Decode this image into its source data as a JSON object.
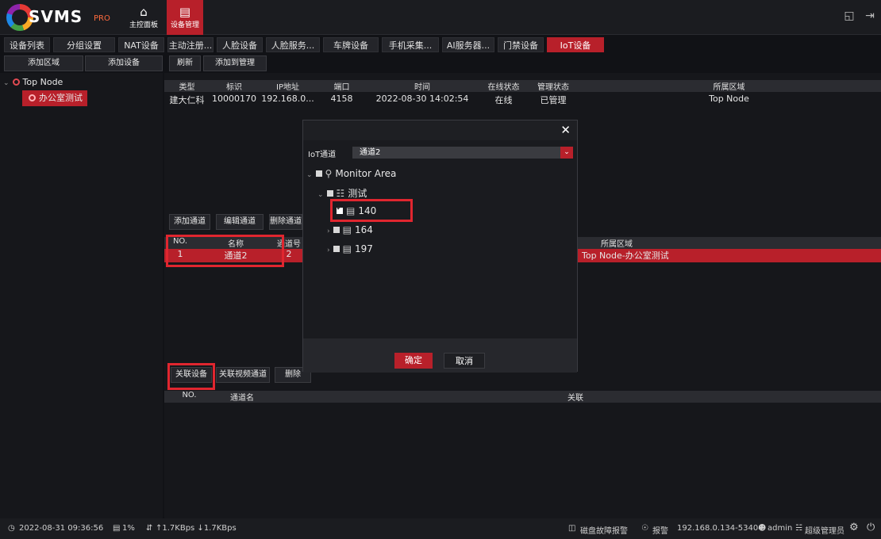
{
  "app": {
    "logo_text": "SVMS",
    "logo_sub": "PRO"
  },
  "topnav": {
    "home_label": "主控面板",
    "device_label": "设备管理"
  },
  "tabs": [
    "设备列表",
    "分组设置",
    "NAT设备",
    "主动注册...",
    "人脸设备",
    "人脸服务...",
    "车牌设备",
    "手机采集...",
    "AI服务器...",
    "门禁设备",
    "IoT设备"
  ],
  "left_toolbar": {
    "add_area": "添加区域",
    "add_device": "添加设备"
  },
  "right_toolbar": {
    "refresh": "刷新",
    "add_to_manage": "添加到管理"
  },
  "tree": {
    "root": "Top Node",
    "child": "办公室测试"
  },
  "device_table": {
    "headers": [
      "类型",
      "标识",
      "IP地址",
      "端口",
      "时间",
      "在线状态",
      "管理状态",
      "所属区域"
    ],
    "rows": [
      [
        "建大仁科",
        "10000170",
        "192.168.0...",
        "4158",
        "2022-08-30 14:02:54",
        "在线",
        "已管理",
        "Top Node"
      ]
    ]
  },
  "channel_toolbar": {
    "add": "添加通道",
    "edit": "编辑通道",
    "delete": "删除通道"
  },
  "channel_table": {
    "headers": [
      "NO.",
      "名称",
      "通道号",
      "所属区域"
    ],
    "rows": [
      [
        "1",
        "通道2",
        "2",
        "Top Node-办公室测试"
      ]
    ]
  },
  "assoc_toolbar": {
    "assoc_device": "关联设备",
    "assoc_video": "关联视频通道",
    "delete": "删除"
  },
  "assoc_table": {
    "headers": [
      "NO.",
      "通道名",
      "关联"
    ]
  },
  "dialog": {
    "field_label": "IoT通道",
    "field_value": "通道2",
    "tree": {
      "root": "Monitor Area",
      "group": "测试",
      "items": [
        "140",
        "164",
        "197"
      ]
    },
    "ok": "确定",
    "cancel": "取消"
  },
  "status": {
    "datetime": "2022-08-31 09:36:56",
    "cpu": "1%",
    "network": "↑1.7KBps ↓1.7KBps",
    "disk_alarm": "磁盘故障报警",
    "alarm": "报警",
    "address": "192.168.0.134-53404",
    "user": "admin",
    "role": "超级管理员"
  },
  "colors": {
    "accent": "#b8202a",
    "highlight": "#e0262f",
    "background": "#111216"
  }
}
